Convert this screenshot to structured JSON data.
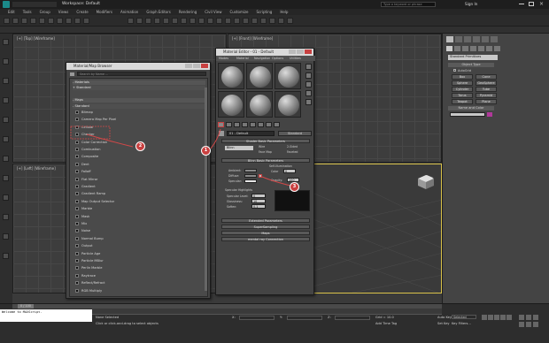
{
  "app": {
    "title": "Workspace: Default",
    "search_placeholder": "Type a keyword or phrase",
    "sign_in": "Sign In",
    "menus": [
      "Edit",
      "Tools",
      "Group",
      "Views",
      "Create",
      "Modifiers",
      "Animation",
      "Graph Editors",
      "Rendering",
      "Civil View",
      "Customize",
      "Scripting",
      "Help"
    ]
  },
  "viewports": {
    "top_label": "[+] [Top] [Wireframe]",
    "front_label": "[+] [Front] [Wireframe]",
    "left_label": "[+] [Left] [Wireframe]",
    "persp_label": "[+] [Perspective] [Realistic]"
  },
  "command_panel": {
    "dropdown": "Standard Primitives",
    "rollout_object_type": "Object Type",
    "autogrid": "AutoGrid",
    "buttons": [
      "Box",
      "Cone",
      "Sphere",
      "GeoSphere",
      "Cylinder",
      "Tube",
      "Torus",
      "Pyramid",
      "Teapot",
      "Plane"
    ],
    "rollout_name_color": "Name and Color"
  },
  "browser": {
    "title": "Material/Map Browser",
    "search_placeholder": "Search by Name ...",
    "sections": [
      "- Materials",
      "+ Standard",
      "- Maps",
      "- Standard"
    ],
    "maps": [
      "Bitmap",
      "Camera Map Per Pixel",
      "Cellular",
      "Checker",
      "Color Correction",
      "Combustion",
      "Composite",
      "Dent",
      "Falloff",
      "Flat Mirror",
      "Gradient",
      "Gradient Ramp",
      "Map Output Selector",
      "Marble",
      "Mask",
      "Mix",
      "Noise",
      "Normal Bump",
      "Output",
      "Particle Age",
      "Particle MBlur",
      "Perlin Marble",
      "Raytrace",
      "Reflect/Refract",
      "RGB Multiply"
    ]
  },
  "material_editor": {
    "title": "Material Editor - 01 - Default",
    "menus": [
      "Modes",
      "Material",
      "Navigation",
      "Options",
      "Utilities"
    ],
    "material_name": "01 - Default",
    "type_button": "Standard",
    "rollouts": {
      "shader_basic": "Shader Basic Parameters",
      "shader_type": "Blinn",
      "wire": "Wire",
      "two_sided": "2-Sided",
      "face_map": "Face Map",
      "faceted": "Faceted",
      "blinn_basic": "Blinn Basic Parameters",
      "self_illumination": "Self-Illumination",
      "color_label": "Color",
      "color_value": "0",
      "ambient": "Ambient:",
      "diffuse": "Diffuse:",
      "specular": "Specular:",
      "opacity_label": "Opacity:",
      "opacity_value": "100",
      "specular_highlights": "Specular Highlights",
      "specular_level": "Specular Level:",
      "specular_level_value": "0",
      "glossiness": "Glossiness:",
      "glossiness_value": "10",
      "soften": "Soften:",
      "soften_value": "0.1",
      "extended": "Extended Parameters",
      "supersampling": "SuperSampling",
      "maps": "Maps",
      "mental_ray": "mental ray Connection"
    }
  },
  "callouts": [
    "1",
    "2",
    "3"
  ],
  "status": {
    "maxscript": "Welcome to MAXScript.",
    "timeline": "0 / 100",
    "selection": "None Selected",
    "hint": "Click or click-and-drag to select objects",
    "x_label": "X:",
    "y_label": "Y:",
    "z_label": "Z:",
    "grid": "Grid = 10.0",
    "add_time_tag": "Add Time Tag",
    "auto_key": "Auto Key",
    "selected": "Selected",
    "set_key": "Set Key",
    "key_filters": "Key Filters..."
  },
  "colors": {
    "accent": "#c94040",
    "viewport_bg": "#3d3d3d",
    "panel_bg": "#444444"
  }
}
